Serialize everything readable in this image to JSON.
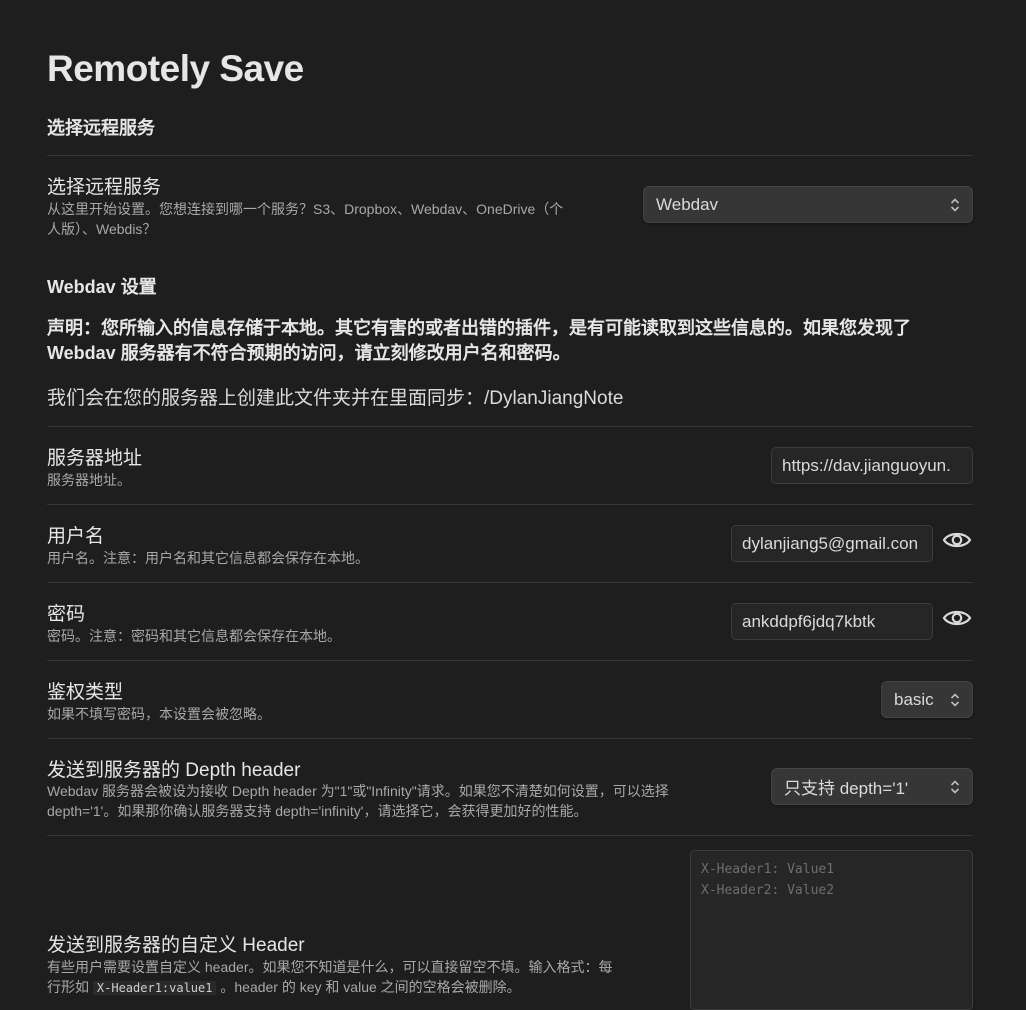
{
  "page_title": "Remotely Save",
  "section_choose_service": "选择远程服务",
  "service": {
    "name": "选择远程服务",
    "desc_line1": "从这里开始设置。您想连接到哪一个服务？S3、Dropbox、Webdav、OneDrive（个",
    "desc_line2": "人版）、Webdis？",
    "selected": "Webdav"
  },
  "webdav_section_title": "Webdav 设置",
  "notice_line1": "声明：您所输入的信息存储于本地。其它有害的或者出错的插件，是有可能读取到这些信息的。如果您发现了",
  "notice_line2": "Webdav 服务器有不符合预期的访问，请立刻修改用户名和密码。",
  "folder_info": "我们会在您的服务器上创建此文件夹并在里面同步：/DylanJiangNote",
  "server": {
    "name": "服务器地址",
    "desc": "服务器地址。",
    "value": "https://dav.jianguoyun."
  },
  "username": {
    "name": "用户名",
    "desc": "用户名。注意：用户名和其它信息都会保存在本地。",
    "value": "dylanjiang5@gmail.con"
  },
  "password": {
    "name": "密码",
    "desc": "密码。注意：密码和其它信息都会保存在本地。",
    "value": "ankddpf6jdq7kbtk"
  },
  "auth": {
    "name": "鉴权类型",
    "desc": "如果不填写密码，本设置会被忽略。",
    "selected": "basic"
  },
  "depth": {
    "name": "发送到服务器的 Depth header",
    "desc_line1": "Webdav 服务器会被设为接收 Depth header 为\"1\"或\"Infinity\"请求。如果您不清楚如何设置，可以选择",
    "desc_line2": "depth='1'。如果那你确认服务器支持 depth='infinity'，请选择它，会获得更加好的性能。",
    "selected": "只支持 depth='1'"
  },
  "custom_header": {
    "name": "发送到服务器的自定义 Header",
    "desc_line1": "有些用户需要设置自定义 header。如果您不知道是什么，可以直接留空不填。输入格式：每",
    "desc_line2_pre": "行形如",
    "desc_code": "X-Header1:value1",
    "desc_line2_post": "。header 的 key 和 value 之间的空格会被删除。",
    "placeholder": "X-Header1: Value1\nX-Header2: Value2"
  },
  "icons": {
    "chevron": "chevron-updown-icon",
    "eye": "eye-icon"
  }
}
